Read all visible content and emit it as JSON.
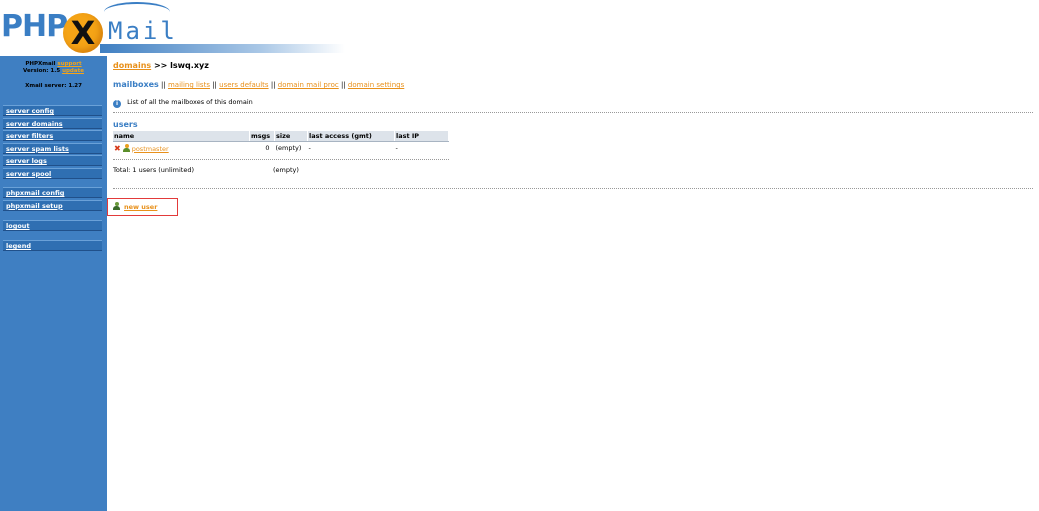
{
  "logo": {
    "php": "PHP",
    "x": "X",
    "mail": "Mail"
  },
  "sidebar": {
    "app_name": "PHPXmail",
    "support_link": "support",
    "version": "Version: 1.5",
    "update_link": "update",
    "server": "Xmail server: 1.27",
    "menu1": [
      "server config",
      "server domains",
      "server filters",
      "server spam lists",
      "server logs",
      "server spool"
    ],
    "menu2": [
      "phpxmail config",
      "phpxmail setup"
    ],
    "menu3": [
      "logout"
    ],
    "menu4": [
      "legend"
    ]
  },
  "breadcrumb": {
    "link": "domains",
    "sep": ">>",
    "domain": "lswq.xyz"
  },
  "tabs": {
    "current": "mailboxes",
    "links": [
      "mailing lists",
      "users defaults",
      "domain mail proc",
      "domain settings"
    ],
    "separator": "||"
  },
  "info_text": "List of all the mailboxes of this domain",
  "section_title": "users",
  "table": {
    "headers": [
      "name",
      "msgs",
      "size",
      "last access (gmt)",
      "last IP"
    ],
    "rows": [
      {
        "name": "postmaster",
        "msgs": "0",
        "size": "(empty)",
        "last_access": "-",
        "last_ip": "-"
      }
    ]
  },
  "total": {
    "label": "Total: 1 users (unlimited)",
    "size": "(empty)"
  },
  "new_user_link": "new user"
}
